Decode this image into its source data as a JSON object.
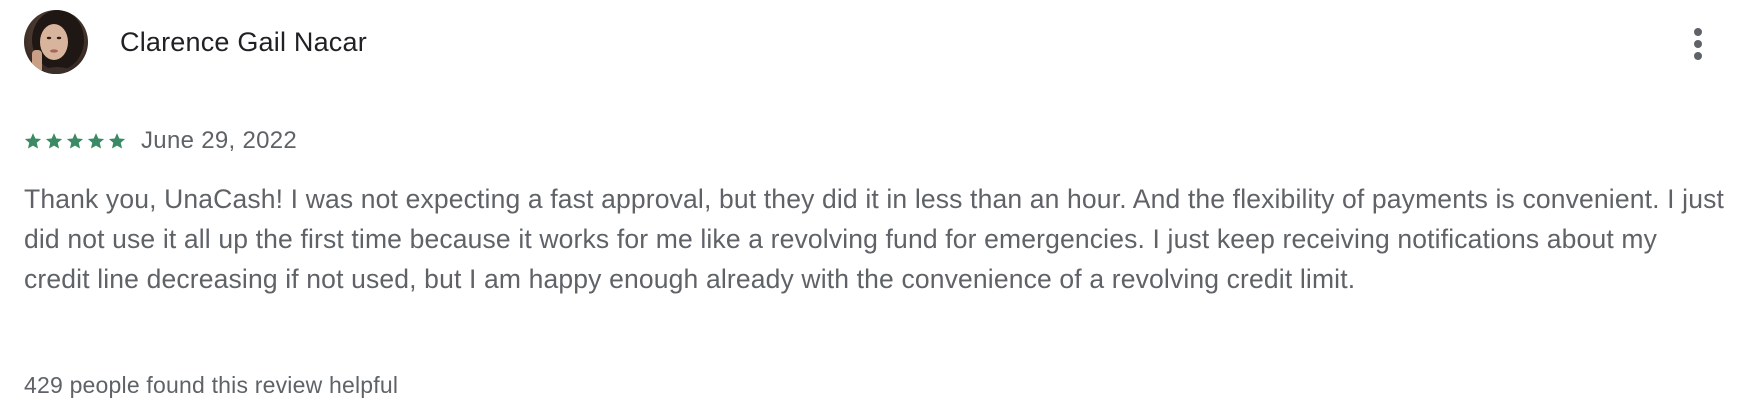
{
  "review": {
    "author_name": "Clarence Gail Nacar",
    "avatar_icon": "user-avatar-photo",
    "more_options_icon": "more-vert-icon",
    "rating": {
      "value": 5,
      "max": 5,
      "star_icon": "star-icon",
      "star_color": "#3b8a66"
    },
    "date": "June 29, 2022",
    "text": "Thank you, UnaCash! I was not expecting a fast approval, but they did it in less than an hour. And the flexibility of payments is convenient. I just did not use it all up the first time because it works for me like a revolving fund for emergencies. I just keep receiving notifications about my credit line decreasing if not used, but I am happy enough already with the convenience of a revolving credit limit.",
    "helpful_text": "429 people found this review helpful"
  },
  "colors": {
    "author_text": "#202124",
    "secondary_text": "#5f6368",
    "icon": "#5f6368",
    "background": "#ffffff"
  }
}
